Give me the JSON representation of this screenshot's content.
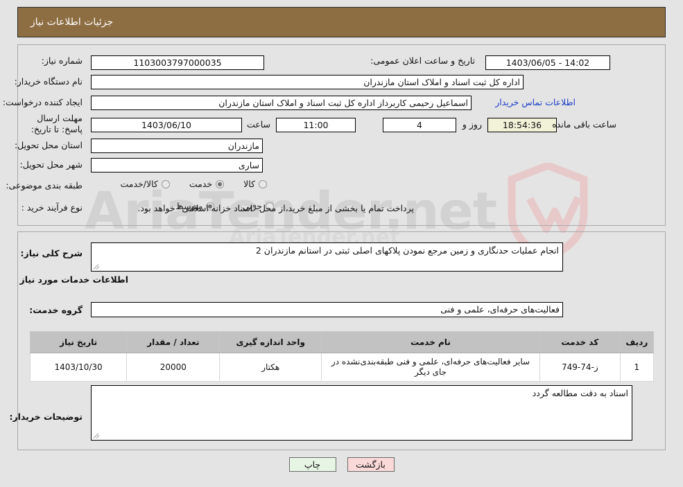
{
  "header": {
    "title": "جزئیات اطلاعات نیاز"
  },
  "watermark": {
    "text": "AriaTender.net",
    "top_text": "AriaTender.net"
  },
  "top_panel": {
    "need_number_label": "شماره نیاز:",
    "need_number_value": "1103003797000035",
    "announce_label": "تاریخ و ساعت اعلان عمومی:",
    "announce_value": "14:02 - 1403/06/05",
    "buyer_org_label": "نام دستگاه خریدار:",
    "buyer_org_value": "اداره کل ثبت اسناد و املاک استان مازندران",
    "creator_label": "ایجاد کننده درخواست:",
    "creator_value": "اسماعیل رحیمی کاربرداز اداره کل ثبت اسناد و املاک استان مازندران",
    "contact_link": "اطلاعات تماس خریدار",
    "deadline_label": "مهلت ارسال پاسخ: تا تاریخ:",
    "deadline_date": "1403/06/10",
    "hour_label": "ساعت",
    "deadline_time": "11:00",
    "days_value": "4",
    "days_label": "روز و",
    "remaining_value": "18:54:36",
    "remaining_label": "ساعت باقی مانده",
    "province_label": "استان محل تحویل:",
    "province_value": "مازندران",
    "city_label": "شهر محل تحویل:",
    "city_value": "ساری",
    "category_label": "طبقه بندی موضوعی:",
    "category_options": [
      {
        "label": "کالا",
        "selected": false
      },
      {
        "label": "خدمت",
        "selected": true
      },
      {
        "label": "کالا/خدمت",
        "selected": false
      }
    ],
    "process_label": "نوع فرآیند خرید :",
    "process_options": [
      {
        "label": "جزیی",
        "selected": false
      },
      {
        "label": "متوسط",
        "selected": true
      }
    ],
    "process_note": "پرداخت تمام یا بخشی از مبلغ خرید،از محل \"اسناد خزانه اسلامی\" خواهد بود."
  },
  "bottom_panel": {
    "summary_label": "شرح کلی نیاز:",
    "summary_value": "انجام عملیات حدنگاری و زمین مرجع نمودن پلاکهای اصلی ثبتی در استانم مازندران 2",
    "services_heading": "اطلاعات خدمات مورد نیاز",
    "service_group_label": "گروه خدمت:",
    "service_group_value": "فعالیت‌های حرفه‌ای، علمی و فنی",
    "table": {
      "columns": [
        "ردیف",
        "کد خدمت",
        "نام خدمت",
        "واحد اندازه گیری",
        "تعداد / مقدار",
        "تاریخ نیاز"
      ],
      "rows": [
        {
          "row": "1",
          "code": "ز-74-749",
          "name": "سایر فعالیت‌های حرفه‌ای، علمی و فنی طبقه‌بندی‌نشده در جای دیگر",
          "unit": "هکتار",
          "qty": "20000",
          "date": "1403/10/30"
        }
      ]
    },
    "notes_label": "توضیحات خریدار:",
    "notes_value": "اسناد به دقت مطالعه گردد"
  },
  "buttons": {
    "print": "چاپ",
    "back": "بازگشت",
    "print_color": "#e7f6e4",
    "back_color": "#fbd9d9"
  }
}
